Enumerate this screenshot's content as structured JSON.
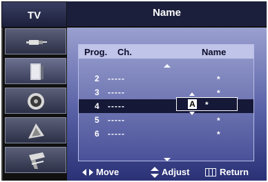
{
  "sidebar": {
    "title": "TV",
    "items": [
      {
        "icon": "input-plug-icon"
      },
      {
        "icon": "picture-panel-icon"
      },
      {
        "icon": "sound-speaker-icon"
      },
      {
        "icon": "channel-satellite-icon"
      },
      {
        "icon": "setup-antenna-icon"
      }
    ]
  },
  "header": {
    "title": "Name"
  },
  "table": {
    "col_prog": "Prog.",
    "col_ch": "Ch.",
    "col_name": "Name",
    "rows": [
      {
        "prog": "2",
        "ch": "-----",
        "name": "*"
      },
      {
        "prog": "3",
        "ch": "-----",
        "name": "*"
      },
      {
        "prog": "4",
        "ch": "-----",
        "name": "*"
      },
      {
        "prog": "5",
        "ch": "-----",
        "name": "*"
      },
      {
        "prog": "6",
        "ch": "-----",
        "name": "*"
      }
    ],
    "selected_row": 2,
    "edit_char": "A",
    "edit_rest": "*"
  },
  "footer": {
    "move": "Move",
    "adjust": "Adjust",
    "return": "Return"
  },
  "colors": {
    "panel_top": "#9aa0cf",
    "panel_bottom": "#2a3175",
    "header": "#1c1f3c",
    "highlight": "#161838"
  }
}
